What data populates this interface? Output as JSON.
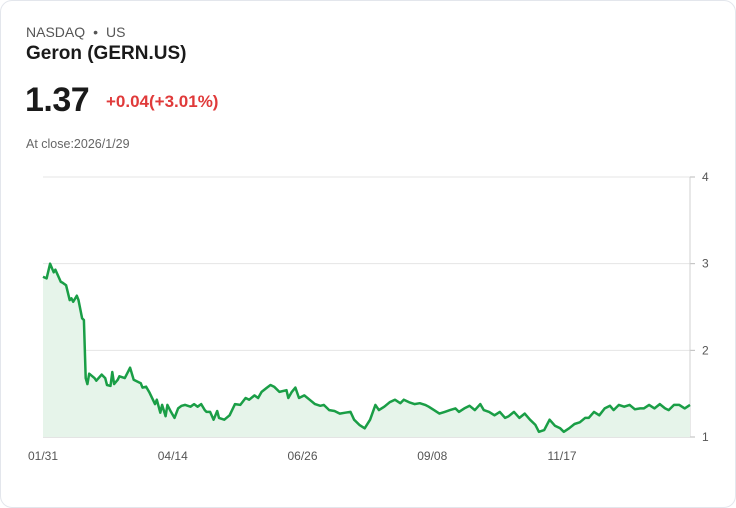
{
  "header": {
    "exchange": "NASDAQ",
    "separator": "•",
    "region": "US",
    "name": "Geron (GERN.US)"
  },
  "quote": {
    "price": "1.37",
    "change": "+0.04(+3.01%)",
    "close_label": "At close:2026/1/29"
  },
  "colors": {
    "line": "#1a9e46",
    "fill": "#e6f4ea",
    "down": "#e03a3a",
    "grid": "#e4e4e4"
  },
  "chart_data": {
    "type": "area",
    "title": "",
    "xlabel": "",
    "ylabel": "",
    "ylim": [
      1,
      4
    ],
    "xlim": [
      0,
      364
    ],
    "yticks": [
      {
        "v": 4,
        "label": "4"
      },
      {
        "v": 3,
        "label": "3"
      },
      {
        "v": 2,
        "label": "2"
      },
      {
        "v": 1,
        "label": "1"
      }
    ],
    "xticks": [
      {
        "v": 0,
        "label": "01/31"
      },
      {
        "v": 73,
        "label": "04/14"
      },
      {
        "v": 146,
        "label": "06/26"
      },
      {
        "v": 219,
        "label": "09/08"
      },
      {
        "v": 292,
        "label": "11/17"
      }
    ],
    "grid": true,
    "points": [
      [
        0,
        2.85
      ],
      [
        2,
        2.83
      ],
      [
        4,
        3.0
      ],
      [
        6,
        2.9
      ],
      [
        7,
        2.93
      ],
      [
        10,
        2.79
      ],
      [
        11,
        2.78
      ],
      [
        13,
        2.75
      ],
      [
        15,
        2.58
      ],
      [
        16,
        2.6
      ],
      [
        17,
        2.56
      ],
      [
        19,
        2.63
      ],
      [
        20,
        2.58
      ],
      [
        22,
        2.37
      ],
      [
        23,
        2.35
      ],
      [
        24,
        1.68
      ],
      [
        25,
        1.61
      ],
      [
        26,
        1.73
      ],
      [
        29,
        1.68
      ],
      [
        30,
        1.65
      ],
      [
        33,
        1.72
      ],
      [
        35,
        1.68
      ],
      [
        36,
        1.6
      ],
      [
        38,
        1.59
      ],
      [
        39,
        1.75
      ],
      [
        40,
        1.61
      ],
      [
        42,
        1.66
      ],
      [
        43,
        1.7
      ],
      [
        46,
        1.68
      ],
      [
        49,
        1.8
      ],
      [
        51,
        1.66
      ],
      [
        55,
        1.62
      ],
      [
        56,
        1.57
      ],
      [
        58,
        1.58
      ],
      [
        60,
        1.51
      ],
      [
        63,
        1.38
      ],
      [
        64,
        1.43
      ],
      [
        66,
        1.28
      ],
      [
        67,
        1.37
      ],
      [
        69,
        1.24
      ],
      [
        70,
        1.37
      ],
      [
        72,
        1.29
      ],
      [
        74,
        1.22
      ],
      [
        76,
        1.33
      ],
      [
        78,
        1.36
      ],
      [
        80,
        1.37
      ],
      [
        83,
        1.35
      ],
      [
        85,
        1.38
      ],
      [
        87,
        1.35
      ],
      [
        89,
        1.38
      ],
      [
        91,
        1.31
      ],
      [
        92,
        1.29
      ],
      [
        94,
        1.29
      ],
      [
        96,
        1.2
      ],
      [
        98,
        1.3
      ],
      [
        99,
        1.22
      ],
      [
        102,
        1.2
      ],
      [
        105,
        1.25
      ],
      [
        108,
        1.38
      ],
      [
        111,
        1.37
      ],
      [
        114,
        1.45
      ],
      [
        116,
        1.43
      ],
      [
        119,
        1.48
      ],
      [
        121,
        1.45
      ],
      [
        123,
        1.52
      ],
      [
        126,
        1.57
      ],
      [
        128,
        1.6
      ],
      [
        130,
        1.58
      ],
      [
        133,
        1.52
      ],
      [
        137,
        1.54
      ],
      [
        138,
        1.45
      ],
      [
        140,
        1.52
      ],
      [
        142,
        1.57
      ],
      [
        144,
        1.45
      ],
      [
        147,
        1.48
      ],
      [
        150,
        1.43
      ],
      [
        153,
        1.38
      ],
      [
        156,
        1.36
      ],
      [
        158,
        1.37
      ],
      [
        161,
        1.31
      ],
      [
        164,
        1.3
      ],
      [
        167,
        1.27
      ],
      [
        170,
        1.28
      ],
      [
        173,
        1.29
      ],
      [
        175,
        1.2
      ],
      [
        178,
        1.14
      ],
      [
        181,
        1.1
      ],
      [
        184,
        1.2
      ],
      [
        187,
        1.37
      ],
      [
        189,
        1.31
      ],
      [
        192,
        1.35
      ],
      [
        195,
        1.4
      ],
      [
        198,
        1.43
      ],
      [
        201,
        1.39
      ],
      [
        203,
        1.43
      ],
      [
        206,
        1.4
      ],
      [
        209,
        1.38
      ],
      [
        212,
        1.39
      ],
      [
        215,
        1.37
      ],
      [
        217,
        1.35
      ],
      [
        220,
        1.31
      ],
      [
        223,
        1.27
      ],
      [
        226,
        1.29
      ],
      [
        229,
        1.31
      ],
      [
        232,
        1.33
      ],
      [
        234,
        1.29
      ],
      [
        237,
        1.33
      ],
      [
        240,
        1.36
      ],
      [
        243,
        1.31
      ],
      [
        246,
        1.38
      ],
      [
        248,
        1.31
      ],
      [
        251,
        1.29
      ],
      [
        254,
        1.25
      ],
      [
        257,
        1.29
      ],
      [
        260,
        1.22
      ],
      [
        262,
        1.24
      ],
      [
        265,
        1.29
      ],
      [
        268,
        1.22
      ],
      [
        271,
        1.27
      ],
      [
        274,
        1.2
      ],
      [
        277,
        1.14
      ],
      [
        279,
        1.06
      ],
      [
        282,
        1.08
      ],
      [
        285,
        1.2
      ],
      [
        288,
        1.13
      ],
      [
        291,
        1.1
      ],
      [
        293,
        1.06
      ],
      [
        296,
        1.1
      ],
      [
        299,
        1.15
      ],
      [
        302,
        1.17
      ],
      [
        305,
        1.22
      ],
      [
        307,
        1.22
      ],
      [
        310,
        1.29
      ],
      [
        313,
        1.25
      ],
      [
        316,
        1.33
      ],
      [
        319,
        1.36
      ],
      [
        321,
        1.31
      ],
      [
        324,
        1.37
      ],
      [
        327,
        1.35
      ],
      [
        330,
        1.37
      ],
      [
        333,
        1.32
      ],
      [
        336,
        1.33
      ],
      [
        338,
        1.33
      ],
      [
        341,
        1.37
      ],
      [
        344,
        1.33
      ],
      [
        347,
        1.38
      ],
      [
        350,
        1.33
      ],
      [
        352,
        1.31
      ],
      [
        355,
        1.37
      ],
      [
        358,
        1.37
      ],
      [
        361,
        1.33
      ],
      [
        364,
        1.37
      ]
    ]
  }
}
